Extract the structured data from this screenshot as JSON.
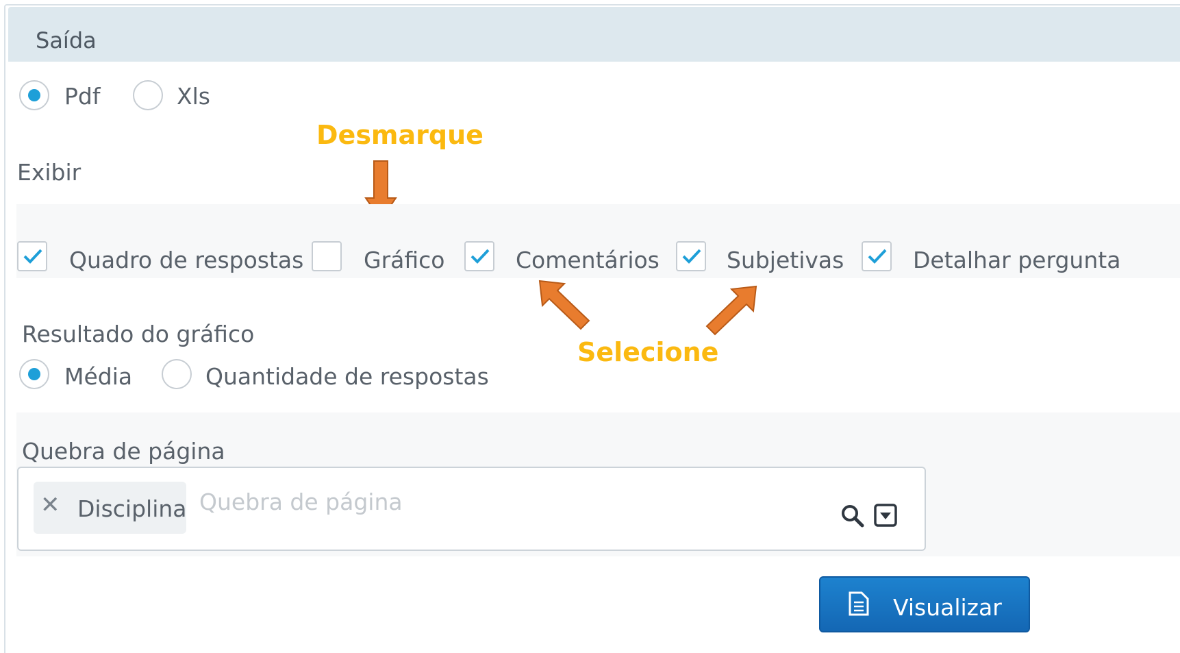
{
  "section": {
    "title": "Saída"
  },
  "output": {
    "options": [
      {
        "label": "Pdf",
        "checked": true
      },
      {
        "label": "Xls",
        "checked": false
      }
    ]
  },
  "exibir": {
    "label": "Exibir",
    "items": [
      {
        "label": "Quadro de respostas",
        "checked": true
      },
      {
        "label": "Gráfico",
        "checked": false
      },
      {
        "label": "Comentários",
        "checked": true
      },
      {
        "label": "Subjetivas",
        "checked": true
      },
      {
        "label": "Detalhar pergunta",
        "checked": true
      }
    ]
  },
  "annotations": {
    "uncheck": "Desmarque",
    "select": "Selecione",
    "color": "#fbb910",
    "arrow_color": "#e87c2e"
  },
  "resultado": {
    "label": "Resultado do gráfico",
    "options": [
      {
        "label": "Média",
        "checked": true
      },
      {
        "label": "Quantidade de respostas",
        "checked": false
      }
    ]
  },
  "quebra": {
    "label": "Quebra de página",
    "tag": "Disciplina",
    "placeholder": "Quebra de página"
  },
  "actions": {
    "visualizar_label": "Visualizar"
  },
  "colors": {
    "accent": "#1e9fd8",
    "button": "#1570c0",
    "header_bg": "#dde8ee"
  }
}
